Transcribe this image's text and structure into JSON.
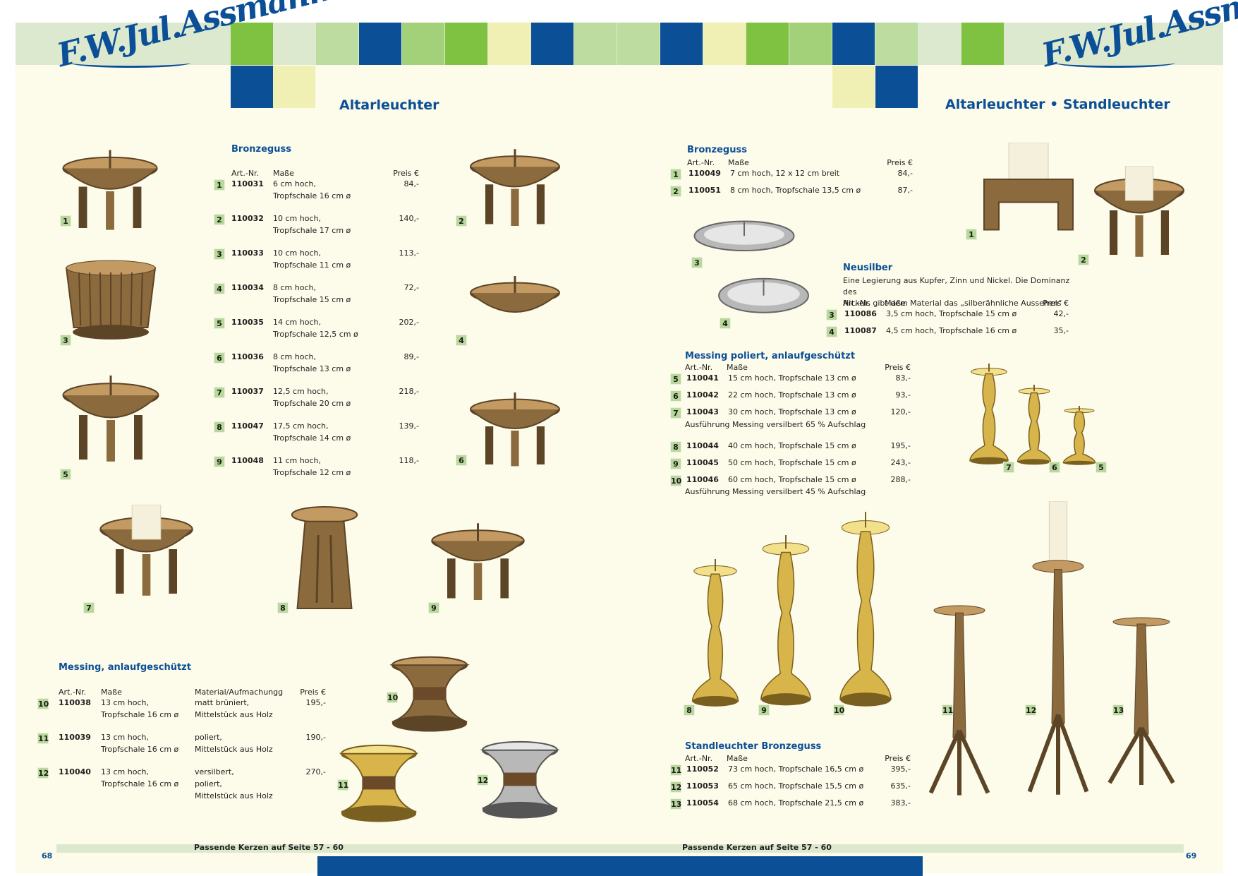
{
  "brand": {
    "logo_text": "F.W.Jul.Assmann"
  },
  "colors": {
    "blue": "#0b4f97",
    "green": "#7fc241",
    "mid_green": "#a3d17a",
    "light_green": "#bcdca0",
    "pale_yellow": "#f0f0b4",
    "pale_green": "#dde9cf",
    "badge": "#b9d89b"
  },
  "left": {
    "title": "Altarleuchter",
    "page_number": "68",
    "footer": "Passende Kerzen auf Seite 57 - 60",
    "bronze": {
      "heading": "Bronzeguss",
      "headers": {
        "art": "Art.-Nr.",
        "mass": "Maße",
        "price": "Preis €"
      },
      "rows": [
        {
          "no": "1",
          "art": "110031",
          "m1": "6 cm hoch,",
          "m2": "Tropfschale 16 cm ø",
          "price": "84,-"
        },
        {
          "no": "2",
          "art": "110032",
          "m1": "10 cm hoch,",
          "m2": "Tropfschale 17 cm ø",
          "price": "140,-"
        },
        {
          "no": "3",
          "art": "110033",
          "m1": "10 cm hoch,",
          "m2": "Tropfschale 11 cm ø",
          "price": "113,-"
        },
        {
          "no": "4",
          "art": "110034",
          "m1": "8 cm hoch,",
          "m2": "Tropfschale 15 cm ø",
          "price": "72,-"
        },
        {
          "no": "5",
          "art": "110035",
          "m1": "14 cm hoch,",
          "m2": "Tropfschale 12,5 cm ø",
          "price": "202,-"
        },
        {
          "no": "6",
          "art": "110036",
          "m1": "8 cm hoch,",
          "m2": "Tropfschale 13 cm ø",
          "price": "89,-"
        },
        {
          "no": "7",
          "art": "110037",
          "m1": "12,5 cm hoch,",
          "m2": "Tropfschale 20 cm ø",
          "price": "218,-"
        },
        {
          "no": "8",
          "art": "110047",
          "m1": "17,5 cm hoch,",
          "m2": "Tropfschale 14 cm ø",
          "price": "139,-"
        },
        {
          "no": "9",
          "art": "110048",
          "m1": "11 cm hoch,",
          "m2": "Tropfschale 12 cm ø",
          "price": "118,-"
        }
      ]
    },
    "messing": {
      "heading": "Messing, anlaufgeschützt",
      "headers": {
        "art": "Art.-Nr.",
        "mass": "Maße",
        "material": "Material/Aufmachungg",
        "price": "Preis €"
      },
      "rows": [
        {
          "no": "10",
          "art": "110038",
          "m1": "13 cm hoch,",
          "m2": "Tropfschale 16 cm ø",
          "t1": "matt brüniert,",
          "t2": "Mittelstück aus Holz",
          "t3": "",
          "price": "195,-"
        },
        {
          "no": "11",
          "art": "110039",
          "m1": "13 cm hoch,",
          "m2": "Tropfschale 16 cm ø",
          "t1": "poliert,",
          "t2": "Mittelstück aus Holz",
          "t3": "",
          "price": "190,-"
        },
        {
          "no": "12",
          "art": "110040",
          "m1": "13 cm hoch,",
          "m2": "Tropfschale 16 cm ø",
          "t1": "versilbert,",
          "t2": "poliert,",
          "t3": "Mittelstück aus Holz",
          "price": "270,-"
        }
      ]
    },
    "photo_labels": [
      "1",
      "2",
      "3",
      "4",
      "5",
      "6",
      "7",
      "8",
      "9",
      "10",
      "11",
      "12"
    ]
  },
  "right": {
    "title": "Altarleuchter • Standleuchter",
    "page_number": "69",
    "footer": "Passende Kerzen auf Seite 57 - 60",
    "bronze": {
      "heading": "Bronzeguss",
      "headers": {
        "art": "Art.-Nr.",
        "mass": "Maße",
        "price": "Preis €"
      },
      "rows": [
        {
          "no": "1",
          "art": "110049",
          "m1": "7 cm hoch, 12 x 12 cm breit",
          "price": "84,-"
        },
        {
          "no": "2",
          "art": "110051",
          "m1": "8 cm hoch, Tropfschale 13,5 cm ø",
          "price": "87,-"
        }
      ]
    },
    "neusilber": {
      "heading": "Neusilber",
      "desc1": "Eine Legierung aus Kupfer, Zinn und Nickel. Die Dominanz des",
      "desc2": "Nickels gibt dem Material das „silberähnliche Aussehen“",
      "headers": {
        "art": "Art.-Nr.",
        "mass": "Maße",
        "price": "Preis €"
      },
      "rows": [
        {
          "no": "3",
          "art": "110086",
          "m1": "3,5 cm hoch, Tropfschale 15 cm ø",
          "price": "42,-"
        },
        {
          "no": "4",
          "art": "110087",
          "m1": "4,5 cm hoch, Tropfschale 16 cm ø",
          "price": "35,-"
        }
      ]
    },
    "messing": {
      "heading": "Messing poliert, anlaufgeschützt",
      "headers": {
        "art": "Art.-Nr.",
        "mass": "Maße",
        "price": "Preis €"
      },
      "rows_a": [
        {
          "no": "5",
          "art": "110041",
          "m1": "15 cm hoch, Tropfschale 13 cm ø",
          "price": "83,-"
        },
        {
          "no": "6",
          "art": "110042",
          "m1": "22 cm hoch, Tropfschale 13 cm ø",
          "price": "93,-"
        },
        {
          "no": "7",
          "art": "110043",
          "m1": "30 cm hoch, Tropfschale 13 cm ø",
          "price": "120,-"
        }
      ],
      "note_a": "Ausführung Messing versilbert 65 % Aufschlag",
      "rows_b": [
        {
          "no": "8",
          "art": "110044",
          "m1": "40 cm hoch, Tropfschale 15 cm ø",
          "price": "195,-"
        },
        {
          "no": "9",
          "art": "110045",
          "m1": "50 cm hoch, Tropfschale 15 cm ø",
          "price": "243,-"
        },
        {
          "no": "10",
          "art": "110046",
          "m1": "60 cm hoch, Tropfschale 15 cm ø",
          "price": "288,-"
        }
      ],
      "note_b": "Ausführung Messing versilbert 45 % Aufschlag"
    },
    "stand": {
      "heading": "Standleuchter Bronzeguss",
      "headers": {
        "art": "Art.-Nr.",
        "mass": "Maße",
        "price": "Preis €"
      },
      "rows": [
        {
          "no": "11",
          "art": "110052",
          "m1": "73 cm hoch, Tropfschale 16,5 cm ø",
          "price": "395,-"
        },
        {
          "no": "12",
          "art": "110053",
          "m1": "65 cm hoch, Tropfschale 15,5 cm ø",
          "price": "635,-"
        },
        {
          "no": "13",
          "art": "110054",
          "m1": "68 cm hoch, Tropfschale 21,5 cm ø",
          "price": "383,-"
        }
      ]
    },
    "photo_labels": [
      "1",
      "2",
      "3",
      "4",
      "7",
      "6",
      "5",
      "8",
      "9",
      "10",
      "11",
      "12",
      "13"
    ]
  }
}
